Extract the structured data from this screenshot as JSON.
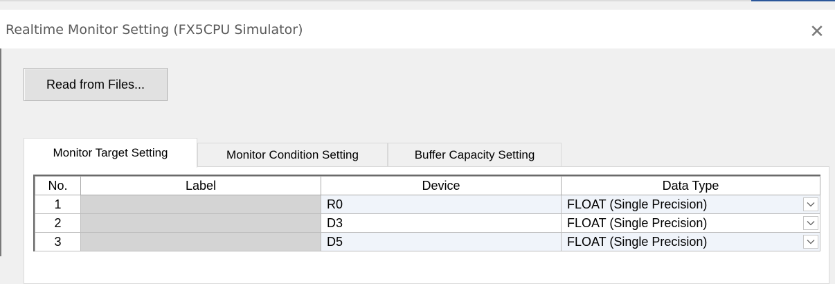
{
  "window": {
    "title": "Realtime Monitor Setting (FX5CPU Simulator)",
    "close_glyph": "✕"
  },
  "toolbar": {
    "read_button": "Read from Files..."
  },
  "tabs": [
    {
      "label": "Monitor Target Setting",
      "active": true
    },
    {
      "label": "Monitor Condition Setting",
      "active": false
    },
    {
      "label": "Buffer Capacity Setting",
      "active": false
    }
  ],
  "table": {
    "headers": [
      "No.",
      "Label",
      "Device",
      "Data Type"
    ],
    "rows": [
      {
        "no": "1",
        "label": "",
        "device": "R0",
        "data_type": "FLOAT (Single Precision)"
      },
      {
        "no": "2",
        "label": "",
        "device": "D3",
        "data_type": "FLOAT (Single Precision)"
      },
      {
        "no": "3",
        "label": "",
        "device": "D5",
        "data_type": "FLOAT (Single Precision)"
      }
    ],
    "dropdown_icon": "chevron-down-icon"
  },
  "colors": {
    "label_cell": "#d4d4d4",
    "row_tint": "#f0f4fa",
    "accent": "#2b579a"
  }
}
